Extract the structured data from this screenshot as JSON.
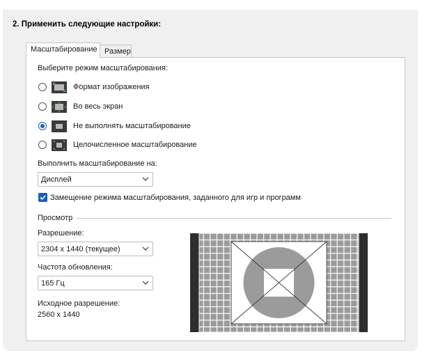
{
  "section_title": "2. Применить следующие настройки:",
  "tabs": [
    {
      "label": "Масштабирование",
      "active": true
    },
    {
      "label": "Размер",
      "active": false
    }
  ],
  "scaling_mode_label": "Выберите режим масштабирования:",
  "scaling_modes": [
    {
      "label": "Формат изображения",
      "icon": "aspect-ratio-icon",
      "checked": false
    },
    {
      "label": "Во весь экран",
      "icon": "full-screen-icon",
      "checked": false
    },
    {
      "label": "Не выполнять масштабирование",
      "icon": "no-scaling-icon",
      "checked": true
    },
    {
      "label": "Целочисленное масштабирование",
      "icon": "integer-scaling-icon",
      "checked": false
    }
  ],
  "perform_on_label": "Выполнить масштабирование на:",
  "perform_on_value": "Дисплей",
  "override_checkbox": {
    "label": "Замещение режима масштабирования, заданного для игр и программ",
    "checked": true
  },
  "preview_label": "Просмотр",
  "resolution_label": "Разрешение:",
  "resolution_value": "2304 x 1440 (текущее)",
  "refresh_label": "Частота обновления:",
  "refresh_value": "165 Гц",
  "native_label": "Исходное разрешение:",
  "native_value": "2560 x 1440",
  "colors": {
    "accent": "#1a5fb4",
    "panel_bg": "#ffffff",
    "outer_bg": "#f0f0f0"
  }
}
